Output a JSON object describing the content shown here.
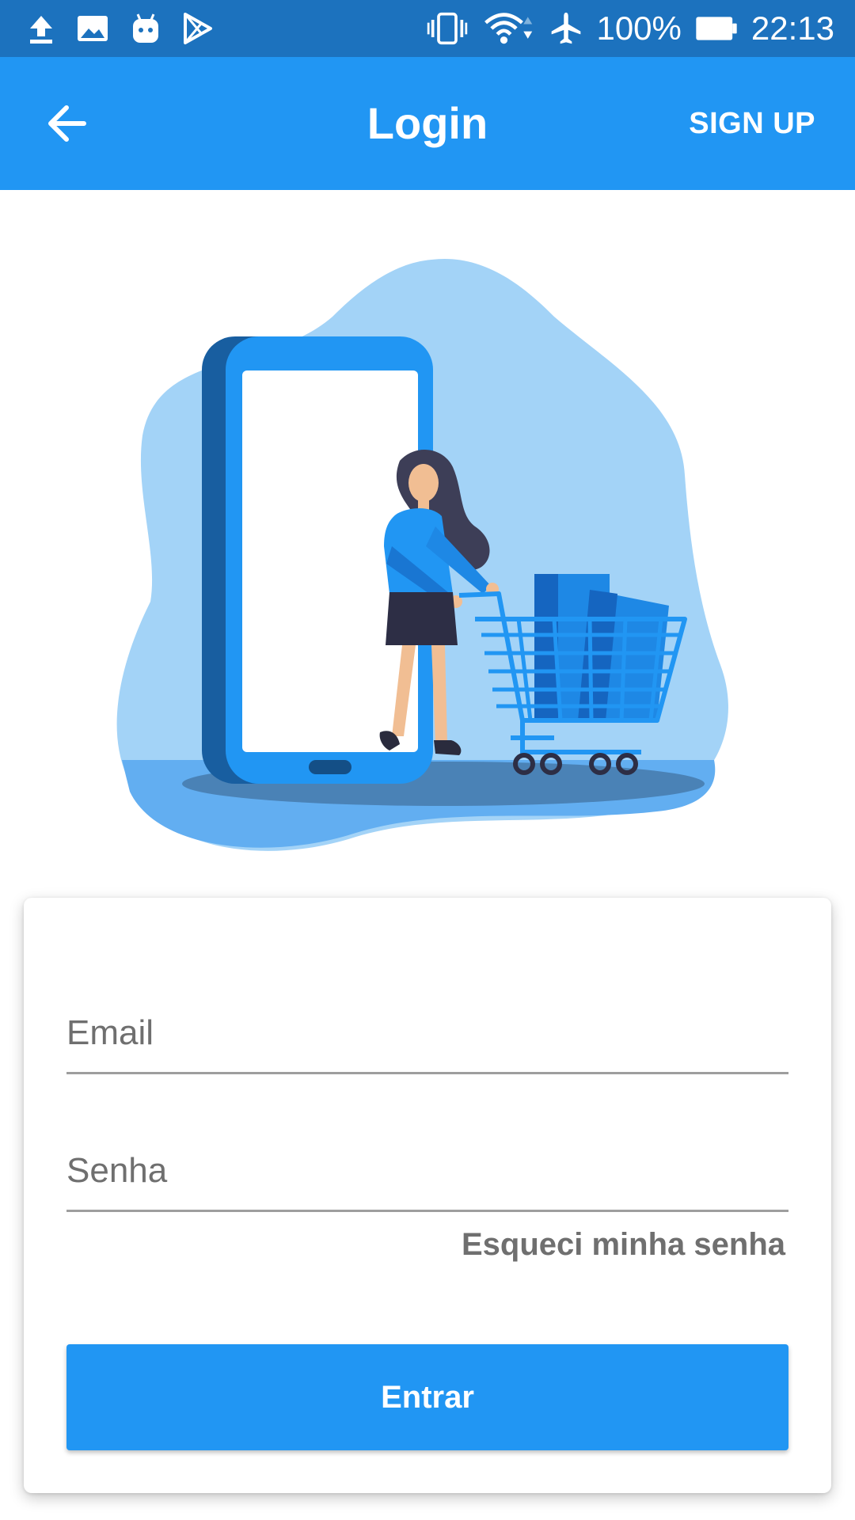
{
  "status_bar": {
    "battery_percent": "100%",
    "time": "22:13",
    "left_icons": [
      "upload-icon",
      "image-icon",
      "android-icon",
      "play-store-icon"
    ],
    "right_icons": [
      "vibrate-icon",
      "wifi-icon",
      "airplane-icon",
      "battery-icon"
    ]
  },
  "app_bar": {
    "title": "Login",
    "back_icon": "arrow-back-icon",
    "signup_label": "SIGN UP"
  },
  "form": {
    "email_placeholder": "Email",
    "password_placeholder": "Senha",
    "forgot_label": "Esqueci minha senha",
    "submit_label": "Entrar"
  },
  "colors": {
    "status_bar": "#1c72be",
    "primary": "#2196f3",
    "illustration_blob": "#a3d3f7",
    "hint_text": "#6f6f6f"
  }
}
